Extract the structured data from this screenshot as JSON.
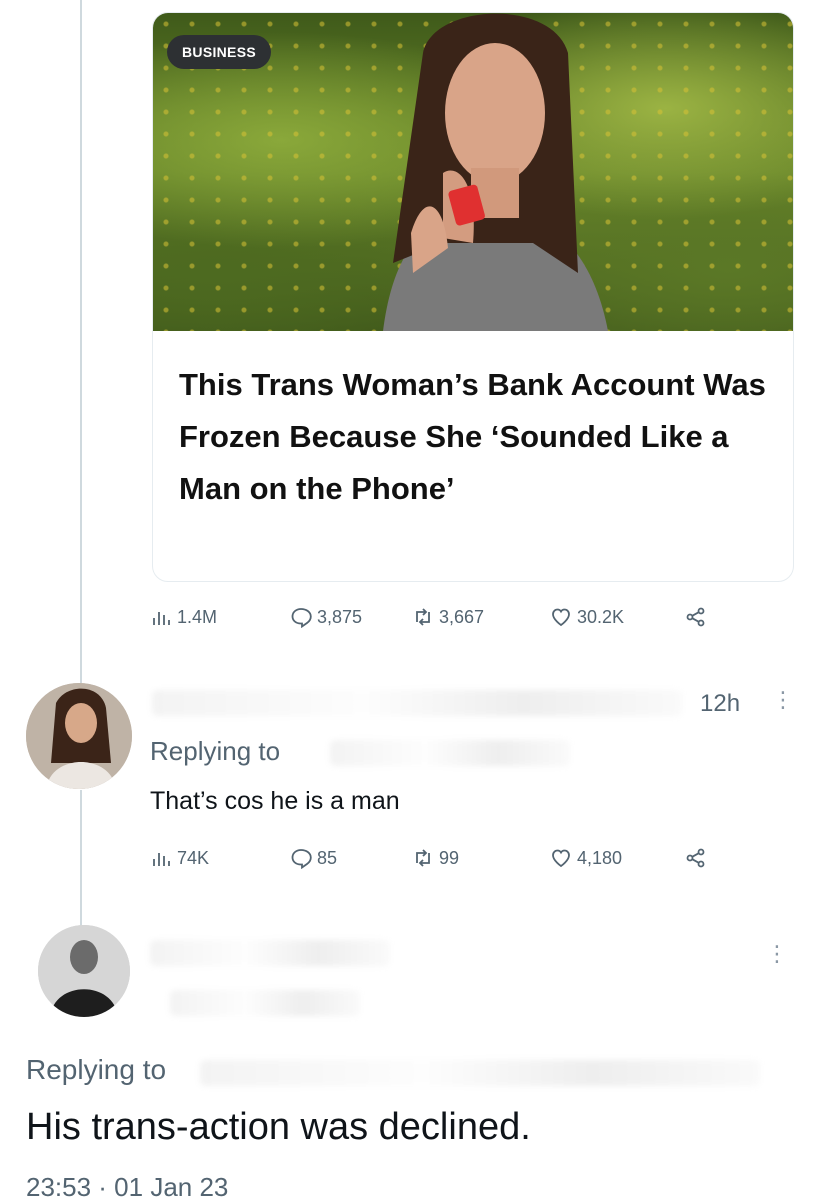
{
  "article": {
    "badge": "BUSINESS",
    "title": "This Trans Woman’s Bank Account Was Frozen Because She ‘Sounded Like a Man on the Phone’"
  },
  "post_stats": {
    "views": "1.4M",
    "replies": "3,875",
    "reposts": "3,667",
    "likes": "30.2K"
  },
  "reply1": {
    "time": "12h",
    "replying_to": "Replying to",
    "text": "That’s cos he is a man",
    "stats": {
      "views": "74K",
      "replies": "85",
      "reposts": "99",
      "likes": "4,180"
    }
  },
  "reply2": {
    "replying_to": "Replying to",
    "text": "His trans-action was declined.",
    "datetime": "23:53 · 01 Jan 23"
  },
  "icons": [
    "views-icon",
    "reply-icon",
    "repost-icon",
    "like-icon",
    "share-icon",
    "more-icon"
  ],
  "colors": {
    "muted": "#536471",
    "text": "#0f1419",
    "border": "#e6ecf0"
  }
}
